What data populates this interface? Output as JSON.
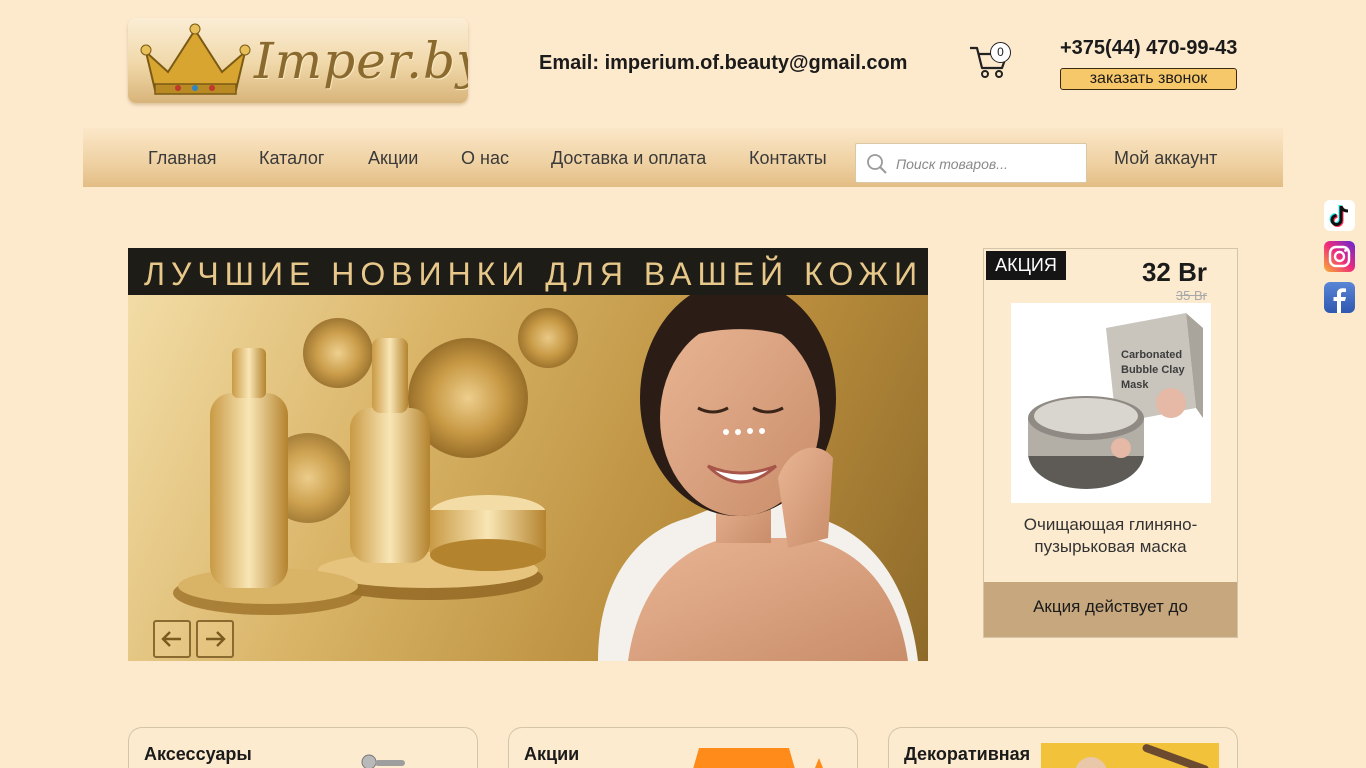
{
  "header": {
    "logo_text": "Imper.by",
    "email": "Email: imperium.of.beauty@gmail.com",
    "cart_count": "0",
    "phone": "+375(44) 470-99-43",
    "callback_label": "заказать звонок"
  },
  "nav": {
    "items": [
      "Главная",
      "Каталог",
      "Акции",
      "О нас",
      "Доставка и оплата",
      "Контакты"
    ],
    "search_placeholder": "Поиск товаров...",
    "account_label": "Мой аккаунт"
  },
  "banner": {
    "title": "ЛУЧШИЕ НОВИНКИ ДЛЯ ВАШЕЙ КОЖИ"
  },
  "promo": {
    "badge": "АКЦИЯ",
    "price": "32 Br",
    "old_price": "35 Br",
    "product_name": "Очищающая глиняно-пузырьковая маска",
    "footer": "Акция действует до",
    "product_image_lettering": "Carbonated Bubble Clay Mask"
  },
  "categories": [
    "Аксессуары",
    "Акции",
    "Декоративная"
  ],
  "social": [
    "tiktok-icon",
    "instagram-icon",
    "facebook-icon"
  ],
  "colors": {
    "background": "#fde9cc",
    "button": "#f7c86a",
    "promo_footer": "#c7a77d"
  }
}
